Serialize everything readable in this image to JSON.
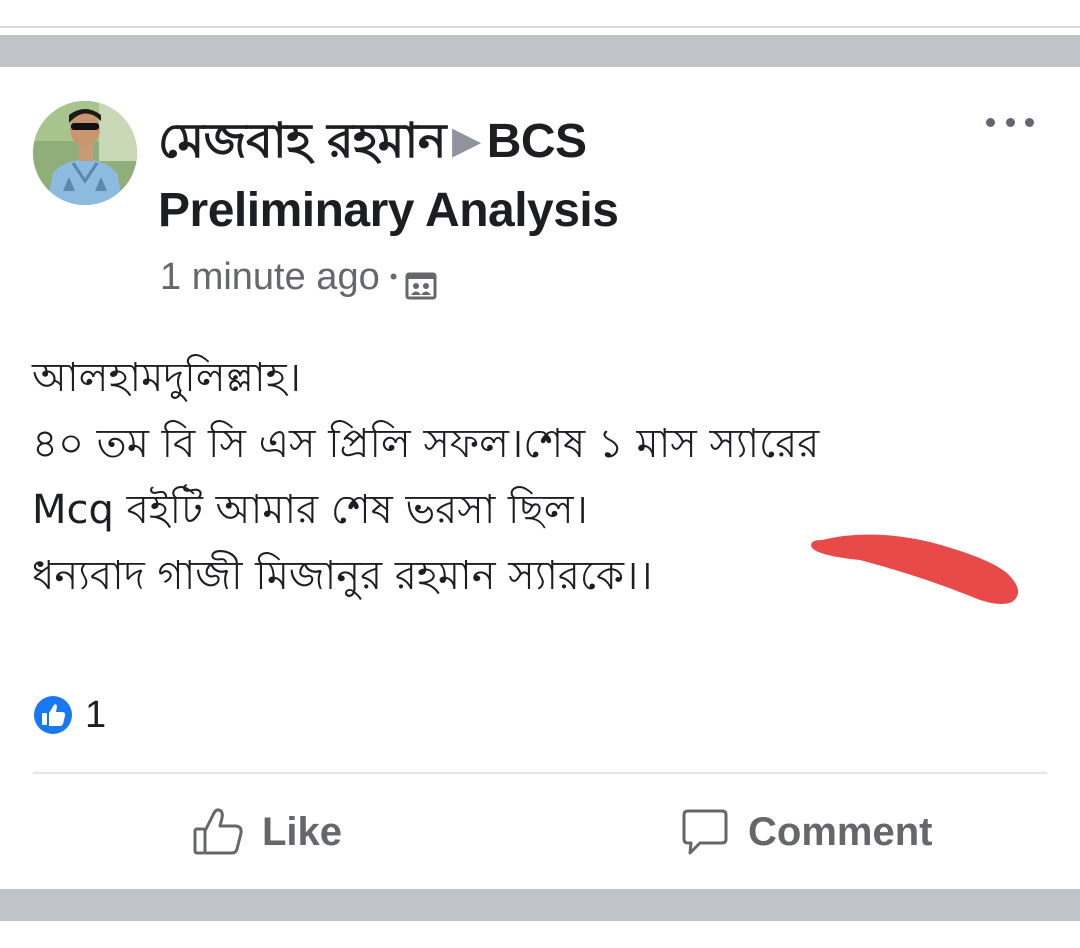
{
  "post": {
    "author": {
      "name": "মেজবাহ রহমান",
      "arrow": "▶",
      "group_line1": "BCS",
      "group_line2": "Preliminary Analysis"
    },
    "timestamp": "1 minute ago",
    "meta_separator": "•",
    "privacy_icon": "group-privacy-icon",
    "body_lines": [
      "আলহামদুলিল্লাহ।",
      "৪০ তম বি সি এস প্রিলি সফল।শেষ ১ মাস স্যারের",
      "Mcq বইটি আমার শেষ ভরসা ছিল।",
      "ধন্যবাদ গাজী মিজানুর রহমান স্যারকে।।"
    ],
    "reactions": {
      "icon": "like-reaction-icon",
      "count": "1"
    },
    "actions": {
      "like_label": "Like",
      "comment_label": "Comment"
    }
  },
  "colors": {
    "band": "#c0c3c8",
    "text_primary": "#1c1e21",
    "text_secondary": "#65676b",
    "like_blue": "#1877f2",
    "highlight_red": "#e84a4a"
  }
}
